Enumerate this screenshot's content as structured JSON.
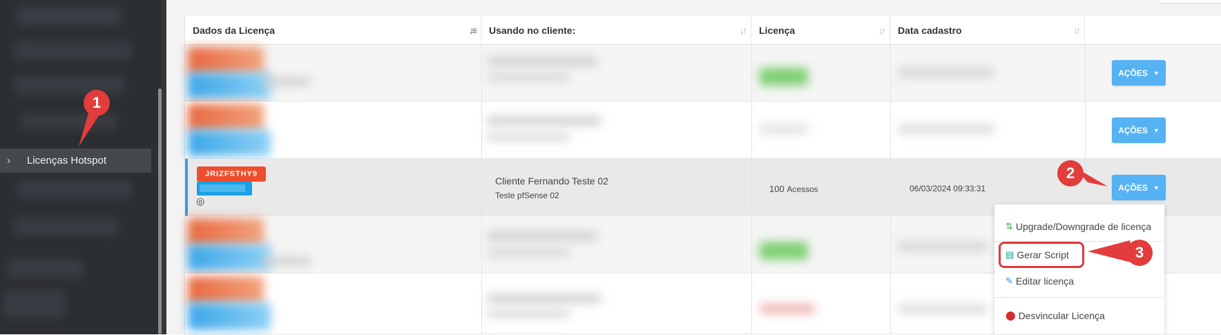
{
  "sidebar": {
    "active_item": {
      "label": "Licenças Hotspot",
      "chevron": "›"
    }
  },
  "table": {
    "columns": [
      {
        "label": "Dados da Licença",
        "sort": "active"
      },
      {
        "label": "Usando no cliente:",
        "sort": "none"
      },
      {
        "label": "Licença",
        "sort": "none"
      },
      {
        "label": "Data cadastro",
        "sort": "none"
      }
    ],
    "action_label": "AÇÕES",
    "selected_row": {
      "license_code": "JRIZFSTHY9",
      "client_name": "Cliente Fernando Teste 02",
      "client_sub": "Teste pfSense 02",
      "license_amount": "100",
      "license_unit": "Acessos",
      "date": "06/03/2024 09:33:31"
    }
  },
  "menu": {
    "items": [
      {
        "label": "Upgrade/Downgrade de licença",
        "icon": "arrows-updown-icon"
      },
      {
        "label": "Gerar Script",
        "icon": "script-icon"
      },
      {
        "label": "Editar licença",
        "icon": "pencil-icon"
      },
      {
        "label": "Desvincular Licença",
        "icon": "alert-icon"
      }
    ]
  },
  "callouts": [
    "1",
    "2",
    "3"
  ],
  "colors": {
    "sidebar_bg": "#2b2e33",
    "button_blue": "#55b2f3",
    "badge_red": "#ee4d2d",
    "callout_red": "#e23c3c",
    "selected_border": "#3a9ae8"
  }
}
